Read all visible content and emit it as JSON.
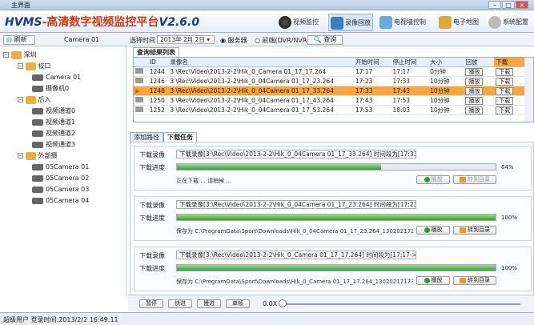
{
  "window": {
    "title": "主界面"
  },
  "header": {
    "brand": "HVMS",
    "brand_cn": "-高清数字视频监控平台",
    "version": "V2.6.0",
    "buttons": [
      {
        "label": "视频监控",
        "icon": "camera-icon"
      },
      {
        "label": "录像回放",
        "icon": "playback-icon"
      },
      {
        "label": "电视墙控制",
        "icon": "tvwall-icon"
      },
      {
        "label": "电子地图",
        "icon": "map-icon"
      },
      {
        "label": "系统配置",
        "icon": "gear-icon"
      }
    ]
  },
  "toolbar": {
    "device_label": "刷新",
    "camera_name": "Camera 01",
    "select_time_label": "选择时间",
    "date_value": "2013年 2月 2日",
    "option_server": "服务器",
    "option_dvr": "前端(DVR/NVR)",
    "query_label": "查询"
  },
  "tree": [
    {
      "level": 0,
      "type": "folder",
      "label": "深圳"
    },
    {
      "level": 1,
      "type": "folder",
      "label": "校口"
    },
    {
      "level": 2,
      "type": "cam",
      "label": "Camera 01"
    },
    {
      "level": 2,
      "type": "cam",
      "label": "摄像机0"
    },
    {
      "level": 1,
      "type": "folder",
      "label": "后入"
    },
    {
      "level": 2,
      "type": "cam",
      "label": "视频通道0"
    },
    {
      "level": 2,
      "type": "cam",
      "label": "视频通道1"
    },
    {
      "level": 2,
      "type": "cam",
      "label": "视频通道2"
    },
    {
      "level": 2,
      "type": "cam",
      "label": "视频通道3"
    },
    {
      "level": 1,
      "type": "folder",
      "label": "外部摄"
    },
    {
      "level": 2,
      "type": "cam",
      "label": "05Camera 01"
    },
    {
      "level": 2,
      "type": "cam",
      "label": "05Camera 02"
    },
    {
      "level": 2,
      "type": "cam",
      "label": "05Camera 03"
    },
    {
      "level": 2,
      "type": "cam",
      "label": "05Camera 04"
    }
  ],
  "results": {
    "tab_label": "查询结果列表",
    "columns": [
      "ID",
      "录像名",
      "开始时间",
      "停止时间",
      "大小",
      "回放",
      "下载"
    ],
    "play_label": "播放",
    "download_label": "下载",
    "rows": [
      {
        "id": "1244",
        "name": "3 \\Rec\\Video\\2013-2-2\\Hik_0_Camera 01_17_17.264",
        "start": "17:17",
        "end": "17:17",
        "size": "0分钟",
        "selected": false
      },
      {
        "id": "1246",
        "name": "3 \\Rec\\Video\\2013-2-2\\Hik_0_04Camera 01_17_23.264",
        "start": "17:23",
        "end": "17:33",
        "size": "10分钟",
        "selected": false
      },
      {
        "id": "1248",
        "name": "3 \\Rec\\Video\\2013-2-2\\Hik_0_04Camera 01_17_33.264",
        "start": "17:33",
        "end": "17:43",
        "size": "10分钟",
        "selected": true
      },
      {
        "id": "1250",
        "name": "3 \\Rec\\Video\\2013-2-2\\Hik_0_04Camera 01_17_43.264",
        "start": "17:43",
        "end": "17:53",
        "size": "10分钟",
        "selected": false
      },
      {
        "id": "1252",
        "name": "3 \\Rec\\Video\\2013-2-2\\Hik_0_04Camera 01_17_53.264",
        "start": "17:53",
        "end": "18:03",
        "size": "10分钟",
        "selected": false
      }
    ]
  },
  "tasks": {
    "tabs": [
      "添加路径",
      "下载任务"
    ],
    "record_label": "下载录像",
    "progress_label": "下载进度",
    "open_btn": "播放",
    "dir_btn": "转到目录",
    "items": [
      {
        "record": "下载录像[3:\\Rec\\Video\\2013-2-2\\Hik_0_04Camera 01_17_33.264] 时间段为[17:33->17:43]",
        "progress": 0.64,
        "percent": "64%",
        "status": "正在下载 ... 请稍候 ...",
        "active": true
      },
      {
        "record": "下载录像[3:\\Rec\\Video\\2013-2-2\\Hik_0_04Camera 01_17_23.264] 时间段为[17:23->17:33]",
        "progress": 1.0,
        "percent": "100%",
        "status": "保存为 C:\\ProgramData\\Sport\\Downloads\\Hik_0_04Camera 01_17_23.264_130202172348-1...",
        "active": false
      },
      {
        "record": "下载录像[3:\\Rec\\Video\\2013-2-2\\Hik_0_Camera 01_17_17.264] 时间段为[17:17->17:17]",
        "progress": 1.0,
        "percent": "100%",
        "status": "保存为 C:\\ProgramData\\Sport\\Downloads\\Hik_0_Camera 01_17_17.264_130202171735-130...",
        "active": false
      }
    ]
  },
  "playback": {
    "pause": "暂停",
    "fast": "快进",
    "slow": "慢进",
    "step": "单帧",
    "speed": "0.0X"
  },
  "status": {
    "text": "超级用户  登录时间:2013/2/2 16:49:11"
  }
}
